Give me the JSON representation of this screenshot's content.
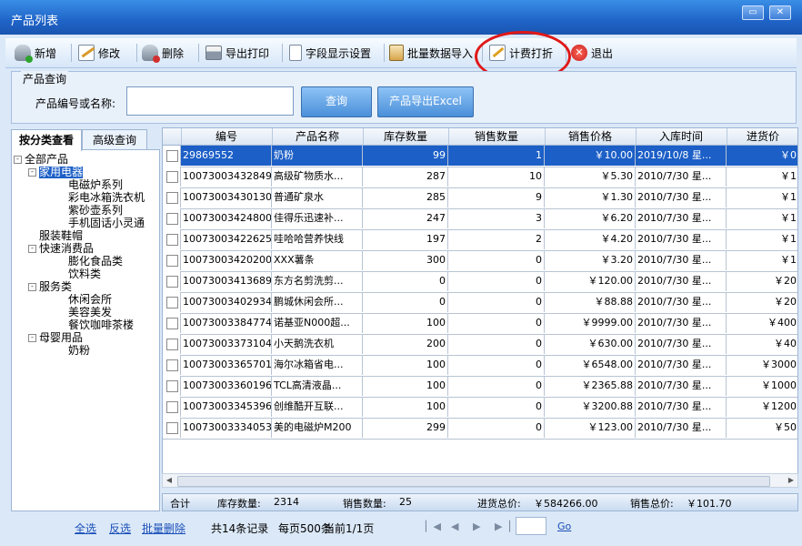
{
  "window": {
    "title": "产品列表"
  },
  "toolbar": {
    "add": "新增",
    "edit": "修改",
    "delete": "删除",
    "print": "导出打印",
    "fields": "字段显示设置",
    "import": "批量数据导入",
    "discount": "计费打折",
    "exit": "退出"
  },
  "query": {
    "legend": "产品查询",
    "label": "产品编号或名称:",
    "value": "",
    "search_btn": "查询",
    "export_btn": "产品导出Excel"
  },
  "left_tabs": [
    "按分类查看",
    "高级查询"
  ],
  "tree": [
    {
      "label": "全部产品",
      "level": 0,
      "expand": "-"
    },
    {
      "label": "家用电器",
      "level": 1,
      "expand": "-",
      "selected": true
    },
    {
      "label": "电磁炉系列",
      "level": 2
    },
    {
      "label": "彩电冰箱洗衣机",
      "level": 2
    },
    {
      "label": "紫砂壶系列",
      "level": 2
    },
    {
      "label": "手机固话小灵通",
      "level": 2
    },
    {
      "label": "服装鞋帽",
      "level": 1
    },
    {
      "label": "快速消费品",
      "level": 1,
      "expand": "-"
    },
    {
      "label": "膨化食品类",
      "level": 2
    },
    {
      "label": "饮料类",
      "level": 2
    },
    {
      "label": "服务类",
      "level": 1,
      "expand": "-"
    },
    {
      "label": "休闲会所",
      "level": 2
    },
    {
      "label": "美容美发",
      "level": 2
    },
    {
      "label": "餐饮咖啡茶楼",
      "level": 2
    },
    {
      "label": "母婴用品",
      "level": 1,
      "expand": "-"
    },
    {
      "label": "奶粉",
      "level": 2
    }
  ],
  "grid": {
    "columns": [
      "编号",
      "产品名称",
      "库存数量",
      "销售数量",
      "销售价格",
      "入库时间",
      "进货价"
    ],
    "rows": [
      {
        "id": "29869552",
        "name": "奶粉",
        "stock": "99",
        "sold": "1",
        "price": "￥10.00",
        "date": "2019/10/8 星...",
        "cost": "￥0",
        "selected": true
      },
      {
        "id": "10073003432849",
        "name": "高级矿物质水...",
        "stock": "287",
        "sold": "10",
        "price": "￥5.30",
        "date": "2010/7/30 星...",
        "cost": "￥1"
      },
      {
        "id": "10073003430130",
        "name": "普通矿泉水",
        "stock": "285",
        "sold": "9",
        "price": "￥1.30",
        "date": "2010/7/30 星...",
        "cost": "￥1"
      },
      {
        "id": "10073003424800",
        "name": "佳得乐迅速补...",
        "stock": "247",
        "sold": "3",
        "price": "￥6.20",
        "date": "2010/7/30 星...",
        "cost": "￥1"
      },
      {
        "id": "10073003422625",
        "name": "哇哈哈营养快线",
        "stock": "197",
        "sold": "2",
        "price": "￥4.20",
        "date": "2010/7/30 星...",
        "cost": "￥1"
      },
      {
        "id": "10073003420200",
        "name": "XXX薯条",
        "stock": "300",
        "sold": "0",
        "price": "￥3.20",
        "date": "2010/7/30 星...",
        "cost": "￥1"
      },
      {
        "id": "10073003413689",
        "name": "东方名剪洗剪...",
        "stock": "0",
        "sold": "0",
        "price": "￥120.00",
        "date": "2010/7/30 星...",
        "cost": "￥20"
      },
      {
        "id": "10073003402934",
        "name": "鹏城休闲会所...",
        "stock": "0",
        "sold": "0",
        "price": "￥88.88",
        "date": "2010/7/30 星...",
        "cost": "￥20"
      },
      {
        "id": "10073003384774",
        "name": "诺基亚N000超...",
        "stock": "100",
        "sold": "0",
        "price": "￥9999.00",
        "date": "2010/7/30 星...",
        "cost": "￥400"
      },
      {
        "id": "10073003373104",
        "name": "小天鹅洗衣机",
        "stock": "200",
        "sold": "0",
        "price": "￥630.00",
        "date": "2010/7/30 星...",
        "cost": "￥40"
      },
      {
        "id": "10073003365701",
        "name": "海尔冰箱省电...",
        "stock": "100",
        "sold": "0",
        "price": "￥6548.00",
        "date": "2010/7/30 星...",
        "cost": "￥3000"
      },
      {
        "id": "10073003360196",
        "name": "TCL高清液晶...",
        "stock": "100",
        "sold": "0",
        "price": "￥2365.88",
        "date": "2010/7/30 星...",
        "cost": "￥1000"
      },
      {
        "id": "10073003345396",
        "name": "创维酷开互联...",
        "stock": "100",
        "sold": "0",
        "price": "￥3200.88",
        "date": "2010/7/30 星...",
        "cost": "￥1200"
      },
      {
        "id": "10073003334053",
        "name": "美的电磁炉M200",
        "stock": "299",
        "sold": "0",
        "price": "￥123.00",
        "date": "2010/7/30 星...",
        "cost": "￥50"
      }
    ]
  },
  "summary": {
    "total": "合计",
    "stock_label": "库存数量:",
    "stock": "2314",
    "sold_label": "销售数量:",
    "sold": "25",
    "cost_label": "进货总价:",
    "cost": "￥584266.00",
    "sales_label": "销售总价:",
    "sales": "￥101.70"
  },
  "footer": {
    "select_all": "全选",
    "invert": "反选",
    "batch_delete": "批量删除",
    "records": "共14条记录",
    "per_page": "每页500条",
    "current": "当前1/1页",
    "go": "Go"
  },
  "colors": {
    "highlight": "#e01818",
    "selection": "#1c5fc7"
  }
}
